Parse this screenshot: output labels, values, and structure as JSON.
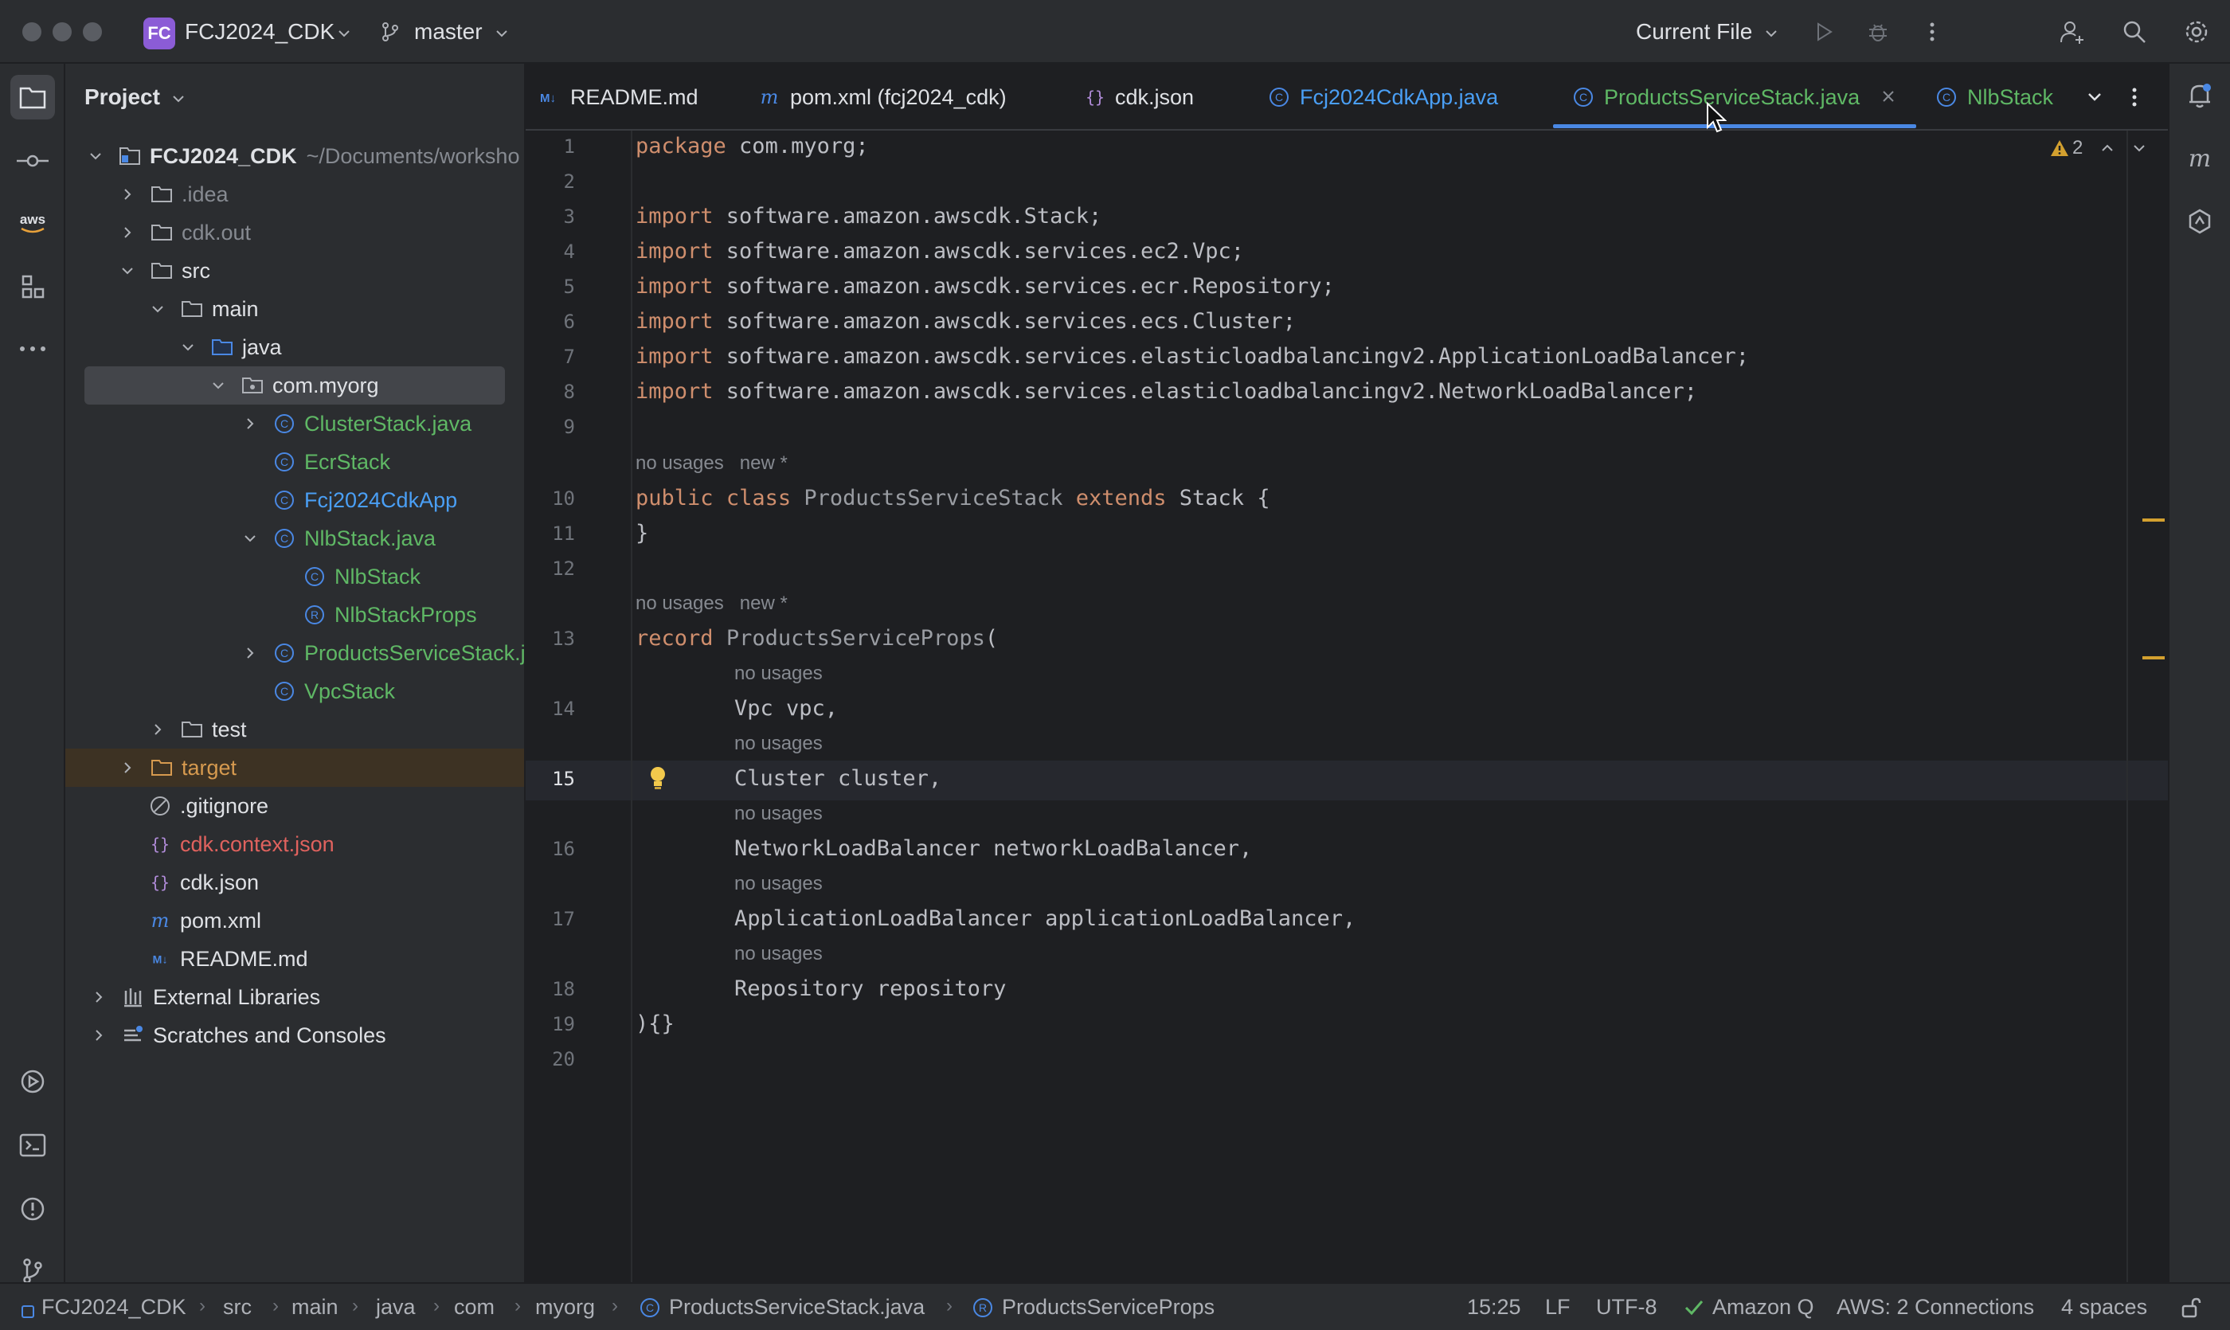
{
  "titlebar": {
    "project_badge": "FC",
    "project_name": "FCJ2024_CDK",
    "branch": "master",
    "run_config": "Current File"
  },
  "project_panel": {
    "title": "Project",
    "tree": [
      {
        "label": "FCJ2024_CDK",
        "extra": "~/Documents/worksho"
      },
      {
        "label": ".idea"
      },
      {
        "label": "cdk.out"
      },
      {
        "label": "src"
      },
      {
        "label": "main"
      },
      {
        "label": "java"
      },
      {
        "label": "com.myorg"
      },
      {
        "label": "ClusterStack.java"
      },
      {
        "label": "EcrStack"
      },
      {
        "label": "Fcj2024CdkApp"
      },
      {
        "label": "NlbStack.java"
      },
      {
        "label": "NlbStack"
      },
      {
        "label": "NlbStackProps"
      },
      {
        "label": "ProductsServiceStack.j"
      },
      {
        "label": "VpcStack"
      },
      {
        "label": "test"
      },
      {
        "label": "target"
      },
      {
        "label": ".gitignore"
      },
      {
        "label": "cdk.context.json"
      },
      {
        "label": "cdk.json"
      },
      {
        "label": "pom.xml"
      },
      {
        "label": "README.md"
      },
      {
        "label": "External Libraries"
      },
      {
        "label": "Scratches and Consoles"
      }
    ]
  },
  "tabs": [
    {
      "label": "README.md"
    },
    {
      "label": "pom.xml (fcj2024_cdk)"
    },
    {
      "label": "cdk.json"
    },
    {
      "label": "Fcj2024CdkApp.java"
    },
    {
      "label": "ProductsServiceStack.java"
    },
    {
      "label": "NlbStack"
    }
  ],
  "editor": {
    "warnings_count": "2",
    "line_numbers": [
      "1",
      "2",
      "3",
      "4",
      "5",
      "6",
      "7",
      "8",
      "9",
      "10",
      "11",
      "12",
      "13",
      "14",
      "15",
      "16",
      "17",
      "18",
      "19",
      "20"
    ],
    "lines": {
      "l1a": "package",
      "l1b": " com.myorg;",
      "imp": "import",
      "l3": " software.amazon.awscdk.Stack;",
      "l4": " software.amazon.awscdk.services.ec2.Vpc;",
      "l5": " software.amazon.awscdk.services.ecr.Repository;",
      "l6": " software.amazon.awscdk.services.ecs.Cluster;",
      "l7": " software.amazon.awscdk.services.elasticloadbalancingv2.ApplicationLoadBalancer;",
      "l8": " software.amazon.awscdk.services.elasticloadbalancingv2.NetworkLoadBalancer;",
      "l10_public": "public",
      "l10_class": "class",
      "l10_name": "ProductsServiceStack",
      "l10_extends": "extends",
      "l10_rest": " Stack {",
      "l11": "}",
      "l13_record": "record",
      "l13_name": "ProductsServiceProps",
      "l13_paren": "(",
      "l14": "Vpc vpc,",
      "l15": "Cluster cluster,",
      "l16": "NetworkLoadBalancer networkLoadBalancer,",
      "l17": "ApplicationLoadBalancer applicationLoadBalancer,",
      "l18": "Repository repository",
      "l19": "){}"
    },
    "hints": {
      "no_usages": "no usages",
      "new": "new *"
    }
  },
  "statusbar": {
    "crumbs": [
      "FCJ2024_CDK",
      "src",
      "main",
      "java",
      "com",
      "myorg",
      "ProductsServiceStack.java",
      "ProductsServiceProps"
    ],
    "position": "15:25",
    "line_sep": "LF",
    "encoding": "UTF-8",
    "amazon_q": "Amazon Q",
    "aws": "AWS: 2 Connections",
    "indent": "4 spaces"
  },
  "colors": {
    "accent": "#4a88e4",
    "warning": "#d3a02f",
    "green_file": "#5fb865",
    "keyword": "#cf8e6d"
  }
}
